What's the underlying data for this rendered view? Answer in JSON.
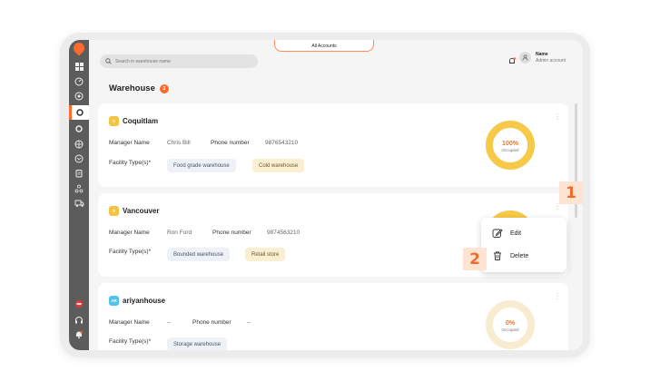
{
  "header": {
    "search_placeholder": "Search in warehouse name",
    "account_tab": "All Accounts",
    "user_name": "Name",
    "user_role": "Admin account"
  },
  "page": {
    "title": "Warehouse",
    "count": "3"
  },
  "labels": {
    "manager": "Manager Name",
    "phone": "Phone number",
    "facility": "Facility Type(s)*",
    "occupied": "Occupied"
  },
  "warehouses": [
    {
      "name": "Coquitlam",
      "initials": "C",
      "badge_color": "#f5c342",
      "manager": "Chris Bill",
      "phone": "9876543210",
      "facilities": [
        "Food grade warehouse",
        "Cold warehouse"
      ],
      "occupied_percent": 100,
      "occupied_label": "100%"
    },
    {
      "name": "Vancouver",
      "initials": "V",
      "badge_color": "#f5c342",
      "manager": "Ron Ford",
      "phone": "9874563210",
      "facilities": [
        "Bounded warehouse",
        "Retail store"
      ],
      "occupied_percent": 100,
      "occupied_label": ""
    },
    {
      "name": "ariyanhouse",
      "initials": "AR",
      "badge_color": "#4fc3e8",
      "manager": "--",
      "phone": "--",
      "facilities": [
        "Storage warehouse"
      ],
      "occupied_percent": 0,
      "occupied_label": "0%"
    }
  ],
  "context_menu": {
    "edit": "Edit",
    "delete": "Delete"
  },
  "steps": {
    "one": "1",
    "two": "2"
  },
  "colors": {
    "accent": "#ff6b2c",
    "ring_full": "#f7c948",
    "ring_empty": "#f7ecd0",
    "sidebar": "#5c5c5c"
  }
}
